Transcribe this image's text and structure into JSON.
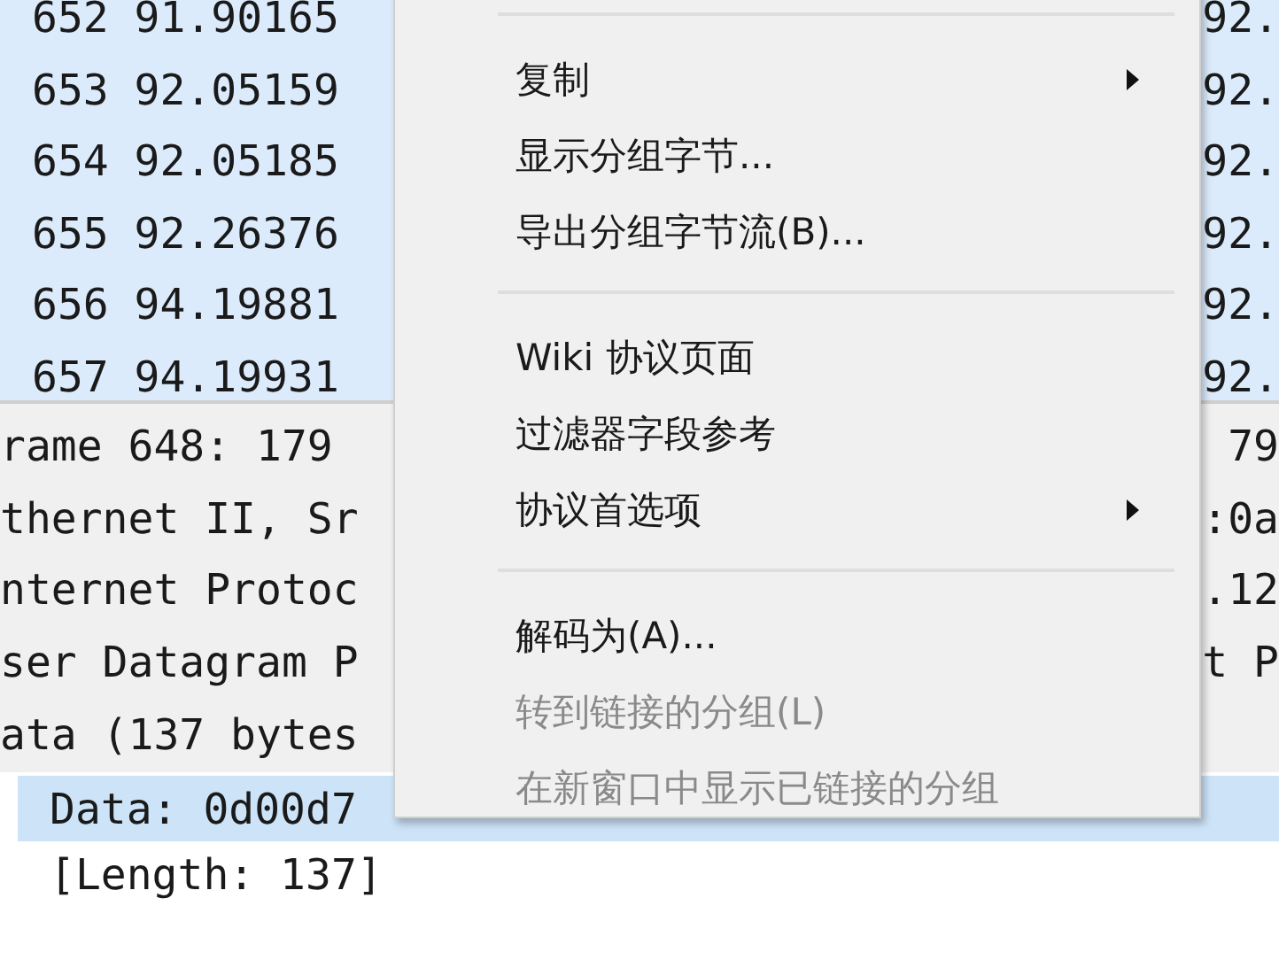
{
  "packet_list": {
    "rows": [
      {
        "no": "652",
        "time": "91.90165",
        "column_3": "92."
      },
      {
        "no": "653",
        "time": "92.05159",
        "column_3": "92."
      },
      {
        "no": "654",
        "time": "92.05185",
        "column_3": "92."
      },
      {
        "no": "655",
        "time": "92.26376",
        "column_3": "92."
      },
      {
        "no": "656",
        "time": "94.19881",
        "column_3": "92."
      },
      {
        "no": "657",
        "time": "94.19931",
        "column_3": "92."
      }
    ]
  },
  "packet_details": {
    "lines": [
      {
        "text": "rame 648: 179",
        "tail": "79"
      },
      {
        "text": "thernet II, Sr",
        "tail": ":0a"
      },
      {
        "text": "nternet Protoc",
        "tail": ".12"
      },
      {
        "text": "ser Datagram P",
        "tail": "t P"
      },
      {
        "text": "ata (137 bytes"
      }
    ],
    "children": [
      {
        "text": "Data: 0d00d7",
        "selected": true
      },
      {
        "text": "[Length: 137]",
        "selected": false
      }
    ]
  },
  "context_menu": {
    "items": [
      {
        "kind": "separator"
      },
      {
        "kind": "item",
        "label": "复制",
        "submenu": true,
        "disabled": false
      },
      {
        "kind": "item",
        "label": "显示分组字节...",
        "submenu": false,
        "disabled": false
      },
      {
        "kind": "item",
        "label": "导出分组字节流(B)...",
        "submenu": false,
        "disabled": false
      },
      {
        "kind": "separator"
      },
      {
        "kind": "item",
        "label": "Wiki 协议页面",
        "submenu": false,
        "disabled": false
      },
      {
        "kind": "item",
        "label": "过滤器字段参考",
        "submenu": false,
        "disabled": false
      },
      {
        "kind": "item",
        "label": "协议首选项",
        "submenu": true,
        "disabled": false
      },
      {
        "kind": "separator"
      },
      {
        "kind": "item",
        "label": "解码为(A)...",
        "submenu": false,
        "disabled": false
      },
      {
        "kind": "item",
        "label": "转到链接的分组(L)",
        "submenu": false,
        "disabled": true
      },
      {
        "kind": "item",
        "label": "在新窗口中显示已链接的分组",
        "submenu": false,
        "disabled": true
      }
    ]
  }
}
